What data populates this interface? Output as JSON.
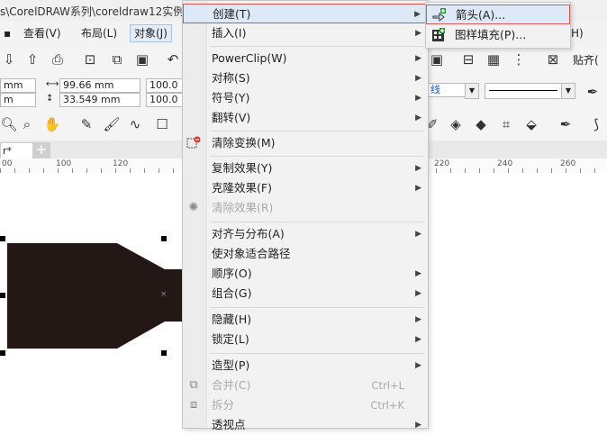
{
  "window": {
    "title": "s\\CorelDRAW系列\\coreldraw12实例视"
  },
  "menubar": {
    "items": [
      "查看(V)",
      "布局(L)",
      "对象(J)"
    ],
    "right_partial": "H)"
  },
  "property_bar": {
    "x_partial": "mm",
    "y_partial": "m",
    "width": "99.66 mm",
    "height": "33.549 mm",
    "scale_x": "100.0",
    "scale_y": "100.0",
    "line_style_partial": "线",
    "wrap_text": "贴齐(",
    "scale_unit_partial": "%"
  },
  "document_tab": {
    "name": "r*"
  },
  "ruler": {
    "labels": [
      "00",
      "100",
      "120",
      "220",
      "240",
      "260"
    ]
  },
  "object_menu": {
    "items": [
      {
        "label": "创建(T)",
        "submenu": true,
        "highlighted": true
      },
      {
        "label": "插入(I)",
        "submenu": true
      },
      {
        "label": "PowerClip(W)",
        "submenu": true
      },
      {
        "label": "对称(S)",
        "submenu": true
      },
      {
        "label": "符号(Y)",
        "submenu": true
      },
      {
        "label": "翻转(V)",
        "submenu": true
      },
      {
        "label": "清除变换(M)",
        "icon": "clear-transform-icon"
      },
      {
        "label": "复制效果(Y)",
        "submenu": true
      },
      {
        "label": "克隆效果(F)",
        "submenu": true
      },
      {
        "label": "清除效果(R)",
        "disabled": true,
        "icon": "clear-effect-icon"
      },
      {
        "label": "对齐与分布(A)",
        "submenu": true
      },
      {
        "label": "使对象适合路径"
      },
      {
        "label": "顺序(O)",
        "submenu": true
      },
      {
        "label": "组合(G)",
        "submenu": true
      },
      {
        "label": "隐藏(H)",
        "submenu": true
      },
      {
        "label": "锁定(L)",
        "submenu": true
      },
      {
        "label": "造型(P)",
        "submenu": true
      },
      {
        "label": "合并(C)",
        "disabled": true,
        "shortcut": "Ctrl+L",
        "icon": "combine-icon"
      },
      {
        "label": "拆分",
        "disabled": true,
        "shortcut": "Ctrl+K",
        "icon": "break-apart-icon"
      },
      {
        "label": "透视点",
        "submenu": true
      }
    ]
  },
  "create_submenu": {
    "items": [
      {
        "label": "箭头(A)...",
        "highlighted": true,
        "icon": "arrow-create-icon"
      },
      {
        "label": "图样填充(P)...",
        "icon": "pattern-fill-icon"
      }
    ]
  },
  "colors": {
    "shape_fill": "#231815",
    "highlight_border": "#d9534f",
    "highlight_bg": "#dde9f7"
  }
}
